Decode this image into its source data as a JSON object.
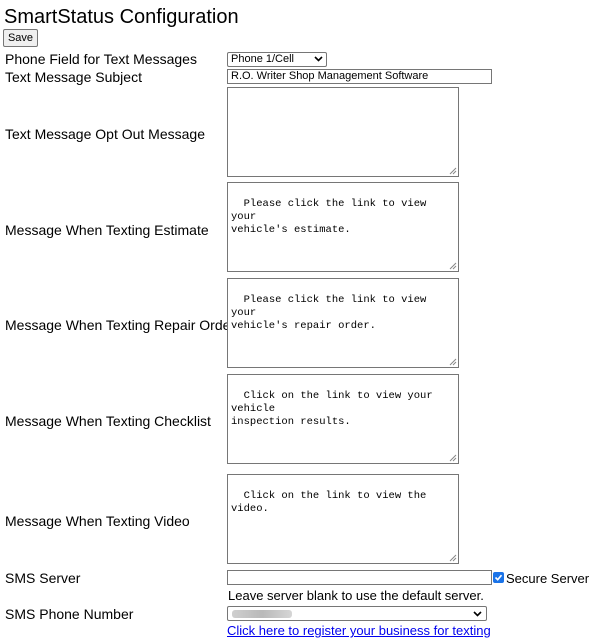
{
  "page": {
    "title": "SmartStatus Configuration"
  },
  "toolbar": {
    "save_label": "Save"
  },
  "fields": {
    "phone_field": {
      "label": "Phone Field for Text Messages",
      "value": "Phone 1/Cell"
    },
    "subject": {
      "label": "Text Message Subject",
      "value": "R.O. Writer Shop Management Software"
    },
    "opt_out": {
      "label": "Text Message Opt Out Message",
      "value": ""
    },
    "estimate": {
      "label": "Message When Texting Estimate",
      "value": "Please click the link to view your\nvehicle's estimate."
    },
    "repair_order": {
      "label": "Message When Texting Repair Order",
      "value": "Please click the link to view your\nvehicle's repair order."
    },
    "checklist": {
      "label": "Message When Texting Checklist",
      "value": "Click on the link to view your vehicle\ninspection results."
    },
    "video": {
      "label": "Message When Texting Video",
      "value": "Click on the link to view the video."
    },
    "sms_server": {
      "label": "SMS Server",
      "value": "",
      "secure_label": "Secure Server",
      "secure_checked": true,
      "note": "Leave server blank to use the default server."
    },
    "sms_phone": {
      "label": "SMS Phone Number",
      "register_link": "Click here to register your business for texting"
    }
  },
  "icons": {
    "dropdown": "chevron-down-icon",
    "resize": "resize-grip-icon",
    "check": "check-icon"
  },
  "colors": {
    "link": "#0000ee",
    "checkbox": "#1a73e8",
    "border": "#767676"
  }
}
